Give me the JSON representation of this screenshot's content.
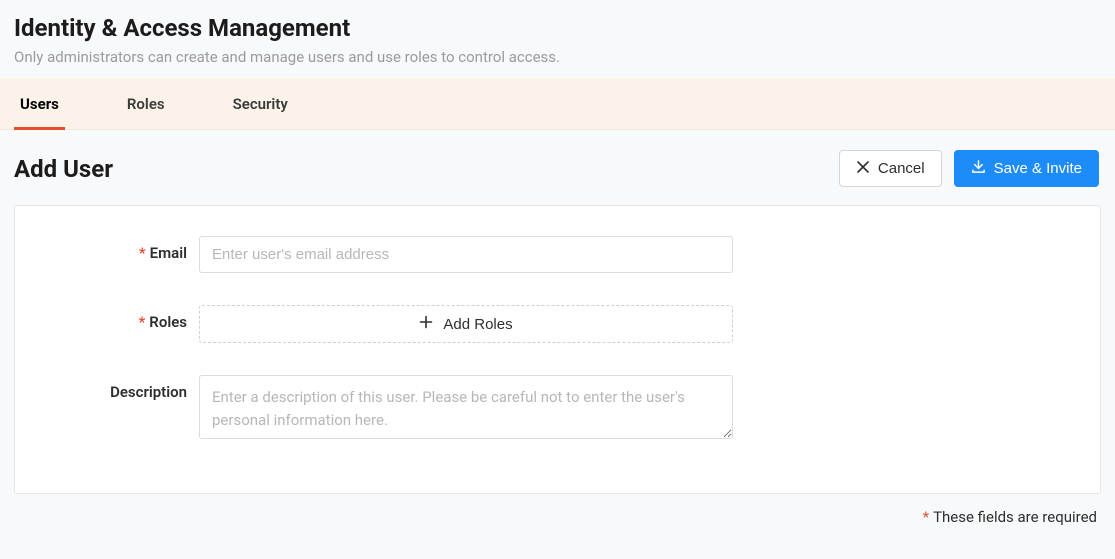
{
  "header": {
    "title": "Identity & Access Management",
    "subtitle": "Only administrators can create and manage users and use roles to control access."
  },
  "tabs": {
    "users_label": "Users",
    "roles_label": "Roles",
    "security_label": "Security",
    "active": "users"
  },
  "section": {
    "title": "Add User"
  },
  "actions": {
    "cancel_label": "Cancel",
    "save_label": "Save & Invite"
  },
  "form": {
    "email": {
      "label": "Email",
      "required": true,
      "placeholder": "Enter user's email address",
      "value": ""
    },
    "roles": {
      "label": "Roles",
      "required": true,
      "add_button_label": "Add Roles"
    },
    "description": {
      "label": "Description",
      "required": false,
      "placeholder": "Enter a description of this user. Please be careful not to enter the user's personal information here.",
      "value": ""
    }
  },
  "footer": {
    "required_note": "These fields are required"
  },
  "colors": {
    "accent_orange": "#e44c2c",
    "primary_blue": "#1d8cf8",
    "tabs_bg": "#fbf2e9"
  }
}
